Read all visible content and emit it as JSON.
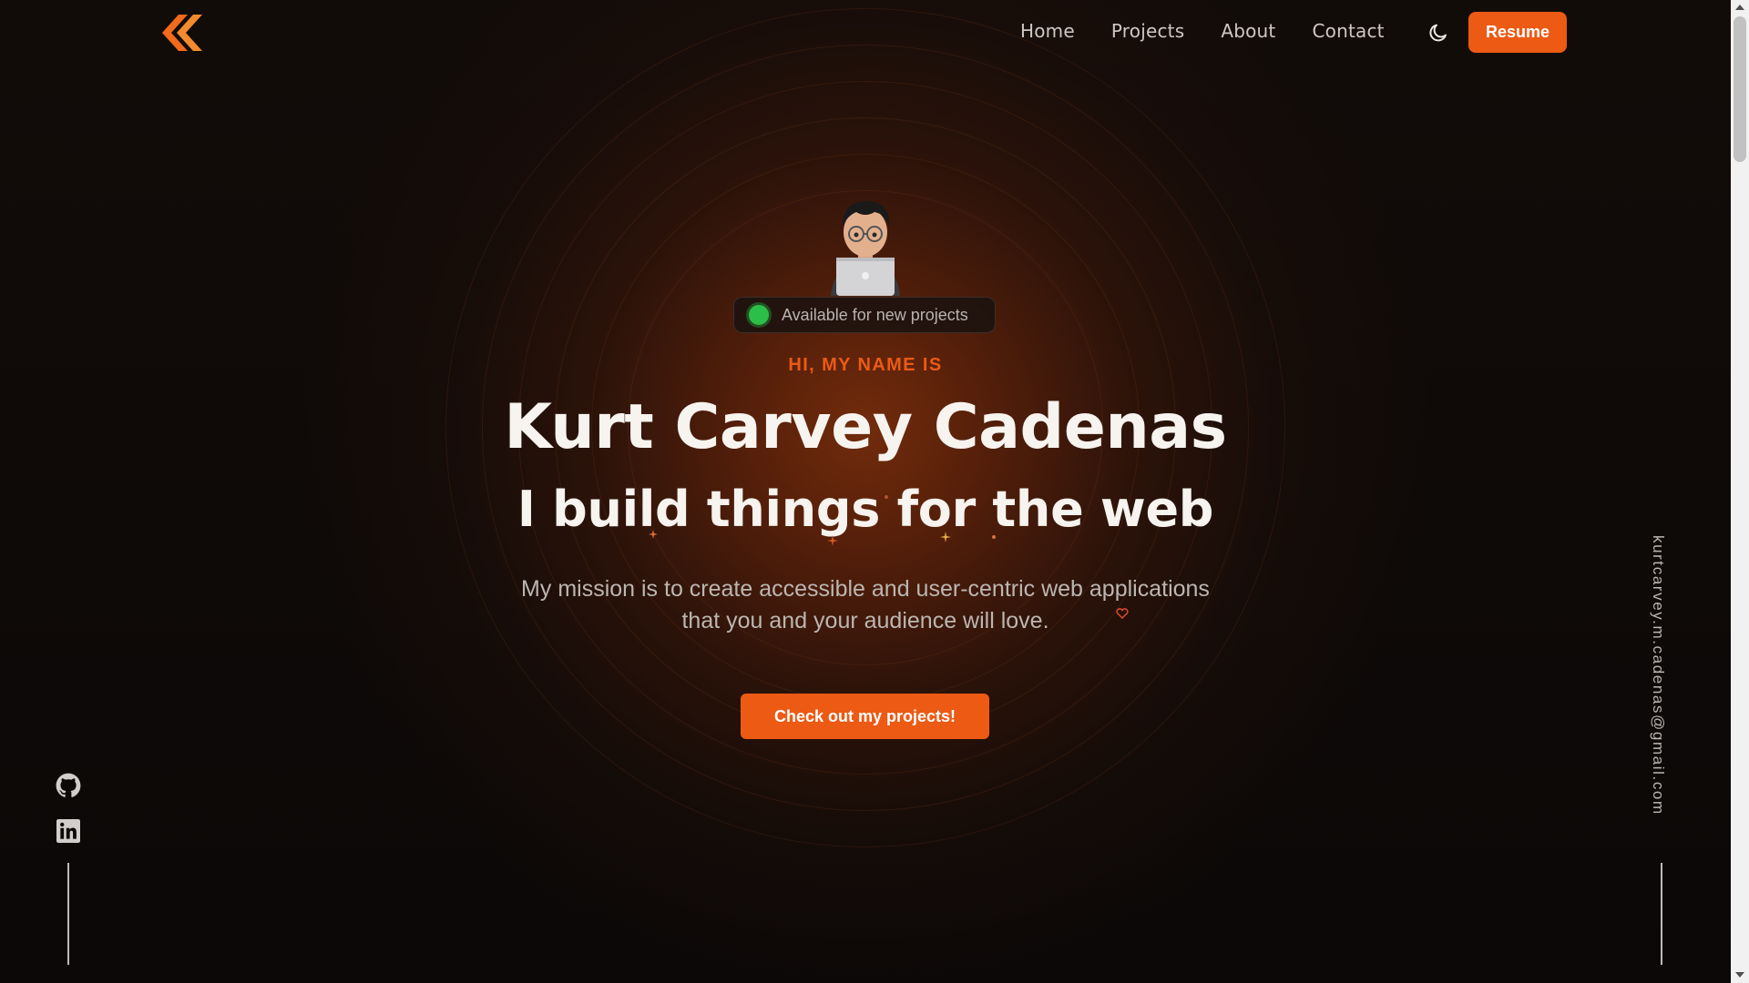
{
  "brand": {
    "logo_icon": "k-chevron-logo-icon",
    "accent_color": "#ec5a14"
  },
  "nav": {
    "items": [
      {
        "label": "Home"
      },
      {
        "label": "Projects"
      },
      {
        "label": "About"
      },
      {
        "label": "Contact"
      }
    ],
    "theme_icon": "moon-icon",
    "resume_label": "Resume"
  },
  "hero": {
    "status_text": "Available for new projects",
    "status_color": "#2bbf4a",
    "intro": "HI, MY NAME IS",
    "name": "Kurt Carvey Cadenas",
    "tagline": "I build things for the web",
    "mission": "My mission is to create accessible and user-centric web applications that you and your audience will love.",
    "cta_label": "Check out my projects!"
  },
  "social": {
    "links": [
      {
        "icon": "github-icon"
      },
      {
        "icon": "linkedin-icon"
      }
    ]
  },
  "email": "kurtcarvey.m.cadenas@gmail.com"
}
